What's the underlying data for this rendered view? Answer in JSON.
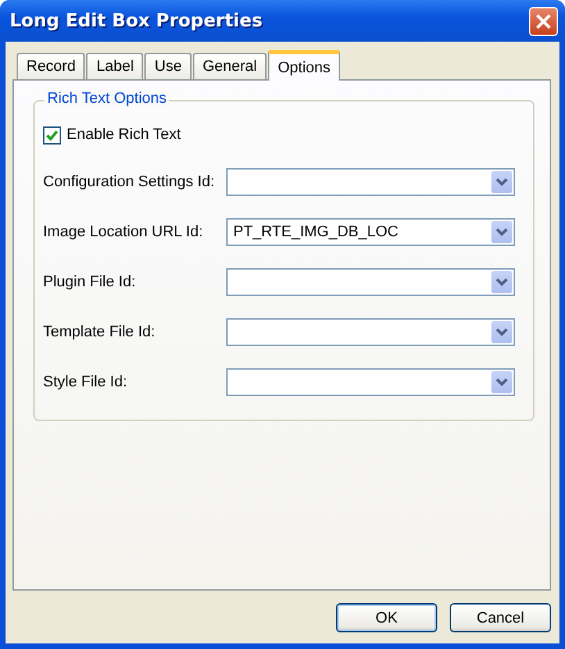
{
  "window": {
    "title": "Long Edit Box Properties"
  },
  "tabs": [
    {
      "label": "Record",
      "selected": false
    },
    {
      "label": "Label",
      "selected": false
    },
    {
      "label": "Use",
      "selected": false
    },
    {
      "label": "General",
      "selected": false
    },
    {
      "label": "Options",
      "selected": true
    }
  ],
  "group": {
    "title": "Rich Text Options",
    "checkbox": {
      "label": "Enable Rich Text",
      "checked": true
    },
    "fields": [
      {
        "label": "Configuration Settings Id:"
      },
      {
        "label": "Image Location URL Id:",
        "value": "PT_RTE_IMG_DB_LOC"
      },
      {
        "label": "Plugin File Id:"
      },
      {
        "label": "Template File Id:"
      },
      {
        "label": "Style File Id:"
      }
    ]
  },
  "buttons": [
    "OK",
    "Cancel"
  ]
}
